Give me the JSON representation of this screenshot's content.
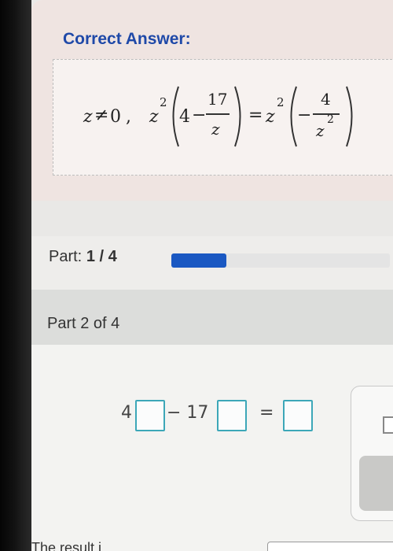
{
  "answer": {
    "heading": "Correct Answer:",
    "condition_var": "z",
    "condition_op": "≠",
    "condition_val": "0",
    "comma": ",",
    "lhs_var": "z",
    "lhs_exp": "2",
    "four": "4",
    "minus": "−",
    "frac_num": "17",
    "frac_den": "z",
    "equals": "=",
    "rhs_var": "z",
    "rhs_exp": "2",
    "rhs_minus": "−",
    "rhs_num": "4",
    "rhs_den_var": "z",
    "rhs_den_exp": "2"
  },
  "progress": {
    "label": "Part:",
    "value": "1 / 4",
    "fraction": 0.25,
    "fill_color": "#1a58c2"
  },
  "part2": {
    "label": "Part 2 of 4"
  },
  "equation": {
    "coef1": "4",
    "op1": "− 17",
    "op2": "="
  },
  "bottom": {
    "text": "The result i"
  }
}
